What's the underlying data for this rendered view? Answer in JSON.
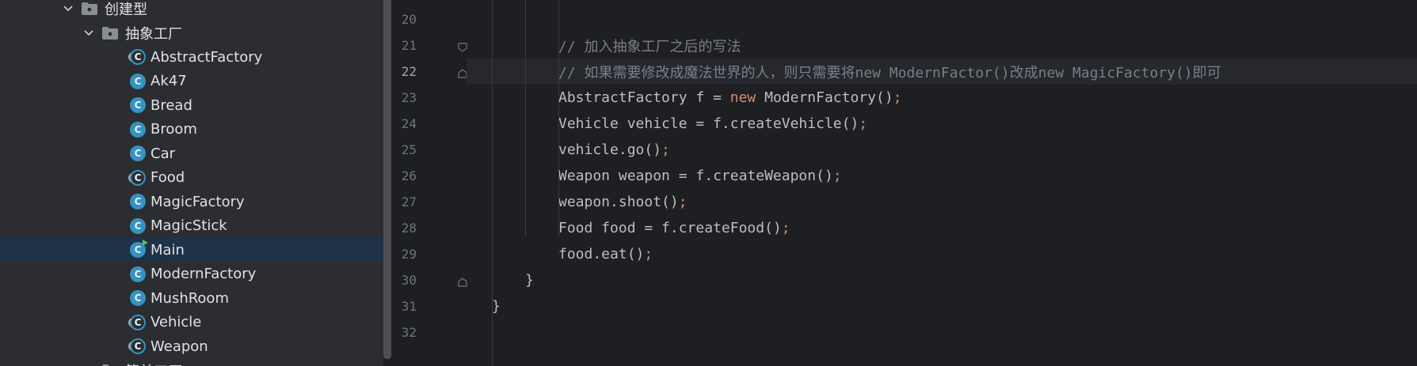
{
  "tree": {
    "items": [
      {
        "label": "创建型",
        "kind": "package",
        "level": 0,
        "expanded": true
      },
      {
        "label": "抽象工厂",
        "kind": "package",
        "level": 1,
        "expanded": true
      },
      {
        "label": "AbstractFactory",
        "kind": "abstract-class"
      },
      {
        "label": "Ak47",
        "kind": "class"
      },
      {
        "label": "Bread",
        "kind": "class"
      },
      {
        "label": "Broom",
        "kind": "class"
      },
      {
        "label": "Car",
        "kind": "class"
      },
      {
        "label": "Food",
        "kind": "abstract-class"
      },
      {
        "label": "MagicFactory",
        "kind": "class"
      },
      {
        "label": "MagicStick",
        "kind": "class"
      },
      {
        "label": "Main",
        "kind": "main-class",
        "selected": true
      },
      {
        "label": "ModernFactory",
        "kind": "class"
      },
      {
        "label": "MushRoom",
        "kind": "class"
      },
      {
        "label": "Vehicle",
        "kind": "abstract-class"
      },
      {
        "label": "Weapon",
        "kind": "abstract-class"
      },
      {
        "label": "简单工厂",
        "kind": "package",
        "level": 1,
        "expanded": false
      }
    ]
  },
  "editor": {
    "current_line": 22,
    "line_numbers": [
      "20",
      "21",
      "22",
      "23",
      "24",
      "25",
      "26",
      "27",
      "28",
      "29",
      "30",
      "31",
      "32"
    ],
    "lines": [
      {
        "indent": 0,
        "tokens": []
      },
      {
        "indent": 2,
        "tokens": [
          {
            "t": "// 加入抽象工厂之后的写法",
            "c": "comment"
          }
        ]
      },
      {
        "indent": 2,
        "tokens": [
          {
            "t": "// 如果需要修改成魔法世界的人，则只需要将new ModernFactor()改成new MagicFactory()即可",
            "c": "comment"
          }
        ]
      },
      {
        "indent": 2,
        "tokens": [
          {
            "t": "AbstractFactory f = ",
            "c": "plain"
          },
          {
            "t": "new",
            "c": "keyword"
          },
          {
            "t": " ModernFactory()",
            "c": "plain"
          },
          {
            "t": ";",
            "c": "semi"
          }
        ]
      },
      {
        "indent": 2,
        "tokens": [
          {
            "t": "Vehicle vehicle = f.createVehicle()",
            "c": "plain"
          },
          {
            "t": ";",
            "c": "semi"
          }
        ]
      },
      {
        "indent": 2,
        "tokens": [
          {
            "t": "vehicle.go()",
            "c": "plain"
          },
          {
            "t": ";",
            "c": "semi"
          }
        ]
      },
      {
        "indent": 2,
        "tokens": [
          {
            "t": "Weapon weapon = f.createWeapon()",
            "c": "plain"
          },
          {
            "t": ";",
            "c": "semi"
          }
        ]
      },
      {
        "indent": 2,
        "tokens": [
          {
            "t": "weapon.shoot()",
            "c": "plain"
          },
          {
            "t": ";",
            "c": "semi"
          }
        ]
      },
      {
        "indent": 2,
        "tokens": [
          {
            "t": "Food food = f.createFood()",
            "c": "plain"
          },
          {
            "t": ";",
            "c": "semi"
          }
        ]
      },
      {
        "indent": 2,
        "tokens": [
          {
            "t": "food.eat()",
            "c": "plain"
          },
          {
            "t": ";",
            "c": "semi"
          }
        ]
      },
      {
        "indent": 1,
        "tokens": [
          {
            "t": "}",
            "c": "plain"
          }
        ]
      },
      {
        "indent": 0,
        "tokens": [
          {
            "t": "}",
            "c": "plain"
          }
        ]
      },
      {
        "indent": 0,
        "tokens": []
      }
    ]
  },
  "colors": {
    "tree_bg": "#2b2d30",
    "editor_bg": "#1e1f22",
    "selection": "#1e3248",
    "class_icon": "#3592c4",
    "keyword": "#cf8e6d",
    "comment": "#7a7e85",
    "plain": "#bcbec4"
  }
}
